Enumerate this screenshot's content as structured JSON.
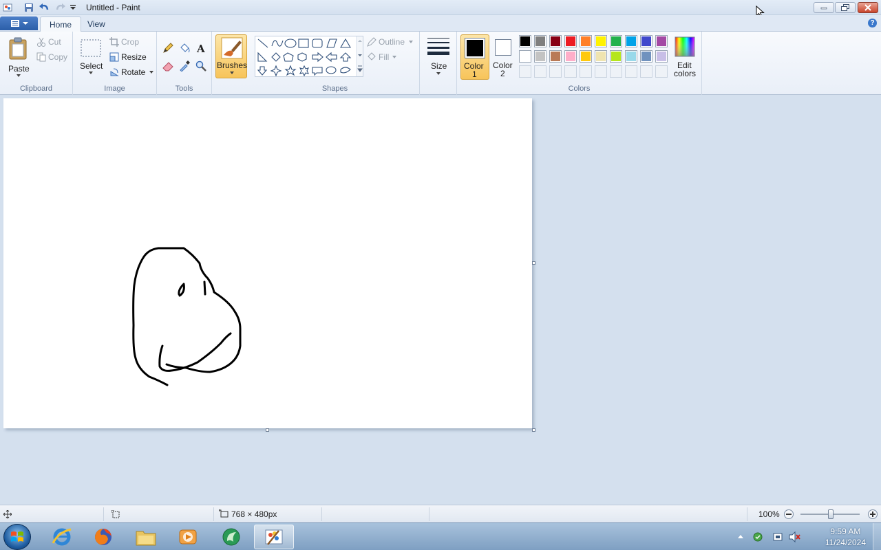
{
  "window": {
    "title": "Untitled - Paint"
  },
  "tabs": {
    "file_menu": "file-menu",
    "home": "Home",
    "view": "View"
  },
  "ribbon": {
    "clipboard": {
      "paste": "Paste",
      "cut": "Cut",
      "copy": "Copy",
      "label": "Clipboard"
    },
    "image": {
      "select": "Select",
      "crop": "Crop",
      "resize": "Resize",
      "rotate": "Rotate",
      "label": "Image"
    },
    "tools": {
      "label": "Tools"
    },
    "brushes": {
      "label": "Brushes"
    },
    "shapes": {
      "outline": "Outline",
      "fill": "Fill",
      "label": "Shapes"
    },
    "size": {
      "label": "Size"
    },
    "colors": {
      "color1_label": "Color",
      "color1_num": "1",
      "color2_label": "Color",
      "color2_num": "2",
      "edit_label": "Edit",
      "edit_label2": "colors",
      "label": "Colors",
      "color1": "#000000",
      "color2": "#ffffff",
      "palette_row1": [
        "#000000",
        "#7f7f7f",
        "#880015",
        "#ed1c24",
        "#ff7f27",
        "#fff200",
        "#22b14c",
        "#00a2e8",
        "#3f48cc",
        "#a349a4"
      ],
      "palette_row2": [
        "#ffffff",
        "#c3c3c3",
        "#b97a57",
        "#ffaec9",
        "#ffc90e",
        "#efe4b0",
        "#b5e61d",
        "#99d9ea",
        "#7092be",
        "#c8bfe7"
      ]
    }
  },
  "status": {
    "canvas_size": "768 × 480px",
    "zoom": "100%"
  },
  "taskbar": {
    "time": "9:59 AM",
    "date": "11/24/2024"
  }
}
